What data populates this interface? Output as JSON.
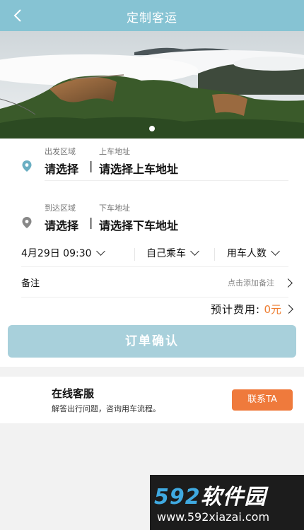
{
  "header": {
    "title": "定制客运"
  },
  "departure": {
    "region_caption": "出发区域",
    "address_caption": "上车地址",
    "region_value": "请选择",
    "separator": "|",
    "address_value": "请选择上车地址"
  },
  "arrival": {
    "region_caption": "到达区域",
    "address_caption": "下车地址",
    "region_value": "请选择",
    "separator": "|",
    "address_value": "请选择下车地址"
  },
  "options": {
    "datetime": "4月29日 09:30",
    "ride_type": "自己乘车",
    "passengers": "用车人数"
  },
  "remark": {
    "label": "备注",
    "hint": "点击添加备注"
  },
  "fee": {
    "label": "预计费用:",
    "amount": "0元"
  },
  "confirm_label": "订单确认",
  "service": {
    "title": "在线客服",
    "description": "解答出行问题，咨询用车流程。",
    "contact_label": "联系TA"
  },
  "watermark": {
    "number": "592",
    "brand": "软件园",
    "url": "www.592xiazai.com"
  },
  "colors": {
    "header": "#86c3d3",
    "confirm": "#a8d0db",
    "accent": "#ef7a3c",
    "pin_blue": "#6aaec2",
    "pin_gray": "#888888"
  }
}
